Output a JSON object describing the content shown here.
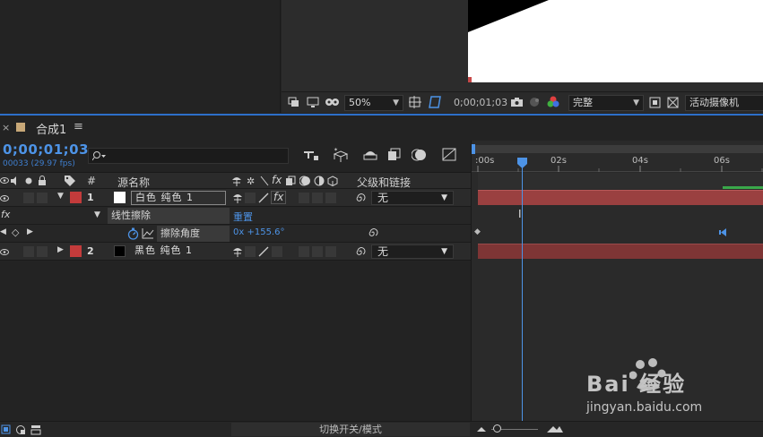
{
  "viewer_toolbar": {
    "zoom": "50%",
    "timecode": "0;00;01;03",
    "resolution": "完整",
    "camera": "活动摄像机"
  },
  "timeline": {
    "tab_label": "合成1",
    "tab_menu": "≡",
    "current_time": "0;00;01;03",
    "frame_info": "00033 (29.97 fps)",
    "search_placeholder": ""
  },
  "columns": {
    "number": "#",
    "source_name": "源名称",
    "parent": "父级和链接"
  },
  "layers": [
    {
      "index": "1",
      "name": "白色 纯色 1",
      "color": "#ffffff",
      "label_color": "#c33b3b",
      "parent": "无"
    },
    {
      "index": "2",
      "name": "黑色 纯色 1",
      "color": "#000000",
      "label_color": "#c33b3b",
      "parent": "无"
    }
  ],
  "effect": {
    "fx": "fx",
    "name": "线性擦除",
    "reset": "重置"
  },
  "property": {
    "name": "擦除角度",
    "value": "0x +155.6°"
  },
  "ruler": {
    "ticks": [
      ":00s",
      "02s",
      "04s",
      "06s"
    ]
  },
  "bottom": {
    "toggle_label": "切换开关/模式"
  },
  "colors": {
    "accent": "#2d6fc9",
    "track": "#9a4040",
    "label": "#c33b3b"
  },
  "watermark": {
    "line1": "Bai 经验",
    "line2": "jingyan.baidu.com"
  }
}
